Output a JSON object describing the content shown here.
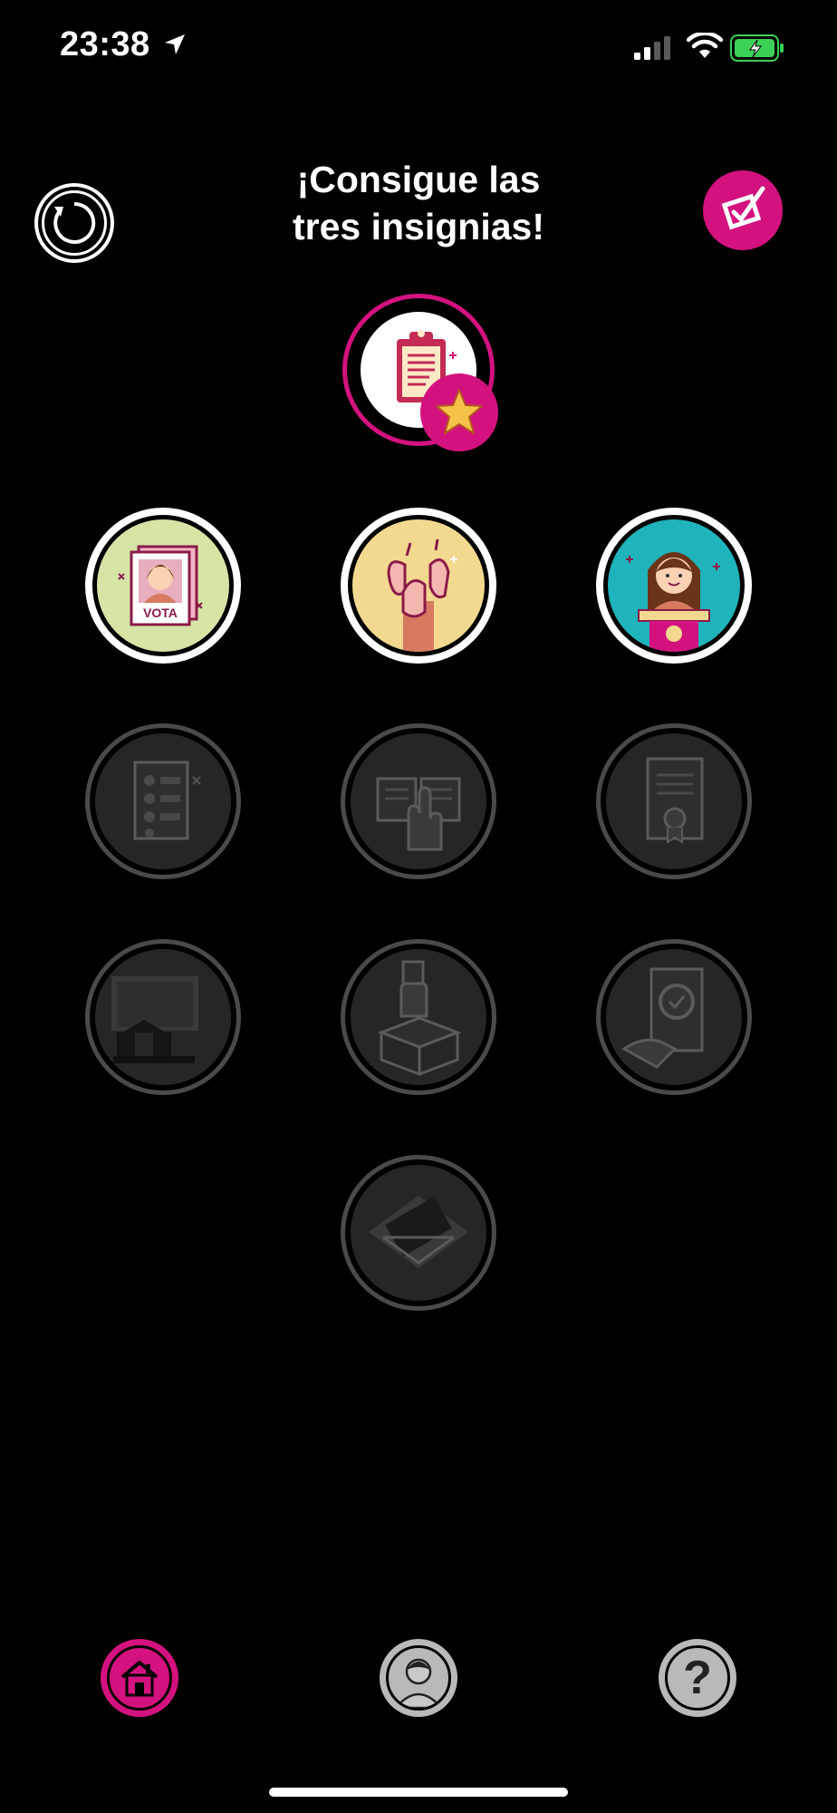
{
  "status_bar": {
    "time": "23:38",
    "icons": [
      "location-arrow-icon",
      "signal-icon",
      "wifi-icon",
      "battery-charging-icon"
    ]
  },
  "header": {
    "title_line1": "¡Consigue las",
    "title_line2": "tres insignias!",
    "reset_icon": "reset-icon",
    "check_icon": "checkbox-icon"
  },
  "main_badge": {
    "icon": "clipboard-icon",
    "star_icon": "star-icon"
  },
  "badges": [
    {
      "id": "vota",
      "unlocked": true,
      "label": "VOTA",
      "icon": "ballot-poster-icon"
    },
    {
      "id": "manos",
      "unlocked": true,
      "icon": "raised-hands-icon"
    },
    {
      "id": "candidata",
      "unlocked": true,
      "icon": "candidate-podium-icon"
    },
    {
      "id": "lista",
      "unlocked": false,
      "icon": "candidate-list-icon"
    },
    {
      "id": "juramento",
      "unlocked": false,
      "icon": "oath-book-icon"
    },
    {
      "id": "certificado",
      "unlocked": false,
      "icon": "certificate-icon"
    },
    {
      "id": "edificio",
      "unlocked": false,
      "icon": "building-icon"
    },
    {
      "id": "urna",
      "unlocked": false,
      "icon": "ballot-box-icon"
    },
    {
      "id": "verificar",
      "unlocked": false,
      "icon": "verify-ballot-icon"
    },
    {
      "id": "geometria",
      "unlocked": false,
      "icon": "diamond-shape-icon"
    }
  ],
  "tab_bar": [
    {
      "id": "home",
      "icon": "home-icon",
      "active": true
    },
    {
      "id": "profile",
      "icon": "profile-icon",
      "active": false
    },
    {
      "id": "help",
      "icon": "help-icon",
      "label": "?",
      "active": false
    }
  ],
  "colors": {
    "accent": "#d4127f",
    "locked": "#4a4a4a",
    "background": "#000000"
  }
}
